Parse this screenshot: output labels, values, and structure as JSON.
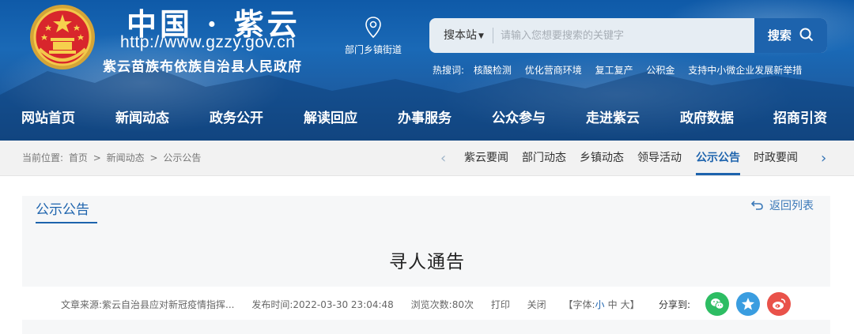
{
  "header": {
    "site_name": "中国 · 紫云",
    "site_url": "http://www.gzzy.gov.cn",
    "org_name": "紫云苗族布依族自治县人民政府",
    "emblem_icon": "national-emblem-icon",
    "dept_link": "部门乡镇街道",
    "search": {
      "scope": "搜本站",
      "placeholder": "请输入您想要搜索的关键字",
      "button": "搜索"
    },
    "hot_label": "热搜词:",
    "hot_words": [
      "核酸检测",
      "优化营商环境",
      "复工复产",
      "公积金",
      "支持中小微企业发展新举措"
    ]
  },
  "nav": [
    "网站首页",
    "新闻动态",
    "政务公开",
    "解读回应",
    "办事服务",
    "公众参与",
    "走进紫云",
    "政府数据",
    "招商引资"
  ],
  "breadcrumb": {
    "label": "当前位置:",
    "items": [
      "首页",
      "新闻动态",
      "公示公告"
    ],
    "separator": ">"
  },
  "subnav": {
    "items": [
      "紫云要闻",
      "部门动态",
      "乡镇动态",
      "领导活动",
      "公示公告",
      "时政要闻"
    ],
    "active": "公示公告",
    "prev_icon": "chevron-left-icon",
    "next_icon": "chevron-right-icon"
  },
  "content": {
    "section_title": "公示公告",
    "back_link": "返回列表",
    "article_title": "寻人通告",
    "meta": {
      "source": "文章来源:紫云自治县应对新冠疫情指挥...",
      "published": "发布时间:2022-03-30 23:04:48",
      "views": "浏览次数:80次",
      "print": "打印",
      "close": "关闭",
      "font_label": "【字体:",
      "font_small": "小",
      "font_medium": "中",
      "font_large": "大】",
      "share_label": "分享到:"
    }
  },
  "colors": {
    "brand_blue": "#1d63ad",
    "wechat": "#2dbd63",
    "qzone": "#3a9de0",
    "weibo": "#e9524a"
  }
}
